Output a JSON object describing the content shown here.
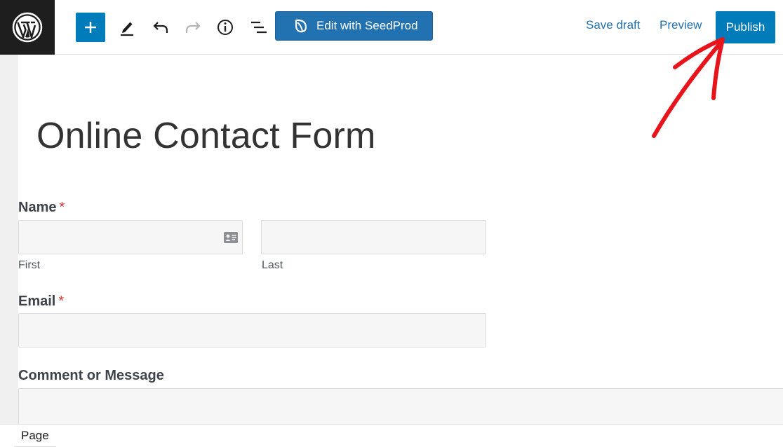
{
  "toolbar": {
    "logo_icon": "wordpress-logo-icon",
    "inserter_icon": "plus-icon",
    "tools_icon": "pencil-icon",
    "undo_icon": "undo-icon",
    "redo_icon": "redo-icon",
    "details_icon": "info-icon",
    "outline_icon": "list-view-icon",
    "seedprod_label": "Edit with SeedProd",
    "seedprod_icon": "seedprod-leaf-icon",
    "save_draft_label": "Save draft",
    "preview_label": "Preview",
    "publish_label": "Publish"
  },
  "page": {
    "title": "Online Contact Form"
  },
  "form": {
    "name": {
      "label": "Name",
      "required_mark": "*",
      "first_sublabel": "First",
      "last_sublabel": "Last",
      "first_value": "",
      "last_value": ""
    },
    "email": {
      "label": "Email",
      "required_mark": "*",
      "value": ""
    },
    "comment": {
      "label": "Comment or Message",
      "value": ""
    }
  },
  "footer": {
    "breadcrumb": "Page"
  },
  "colors": {
    "accent": "#007cba",
    "seedprod": "#2271b1",
    "required": "#d63638",
    "annotation": "#e8141c"
  }
}
